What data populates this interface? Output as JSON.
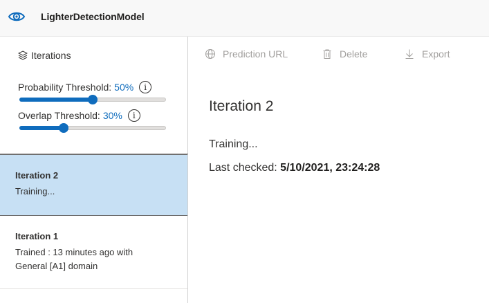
{
  "app": {
    "title": "LighterDetectionModel",
    "icon": "eye-icon",
    "accent_color": "#0f6cbd"
  },
  "sidebar": {
    "heading": "Iterations",
    "heading_icon": "layers-icon",
    "probability": {
      "label": "Probability Threshold:",
      "value_text": "50%",
      "value": 0.5
    },
    "overlap": {
      "label": "Overlap Threshold:",
      "value_text": "30%",
      "value": 0.3
    },
    "iterations": [
      {
        "name": "Iteration 2",
        "status": "Training...",
        "selected": true
      },
      {
        "name": "Iteration 1",
        "status": "Trained : 13 minutes ago with General [A1] domain",
        "selected": false
      }
    ]
  },
  "toolbar": {
    "prediction_url": "Prediction URL",
    "delete": "Delete",
    "export": "Export"
  },
  "detail": {
    "title": "Iteration 2",
    "status": "Training...",
    "last_checked_label": "Last checked:",
    "last_checked_value": "5/10/2021, 23:24:28"
  }
}
